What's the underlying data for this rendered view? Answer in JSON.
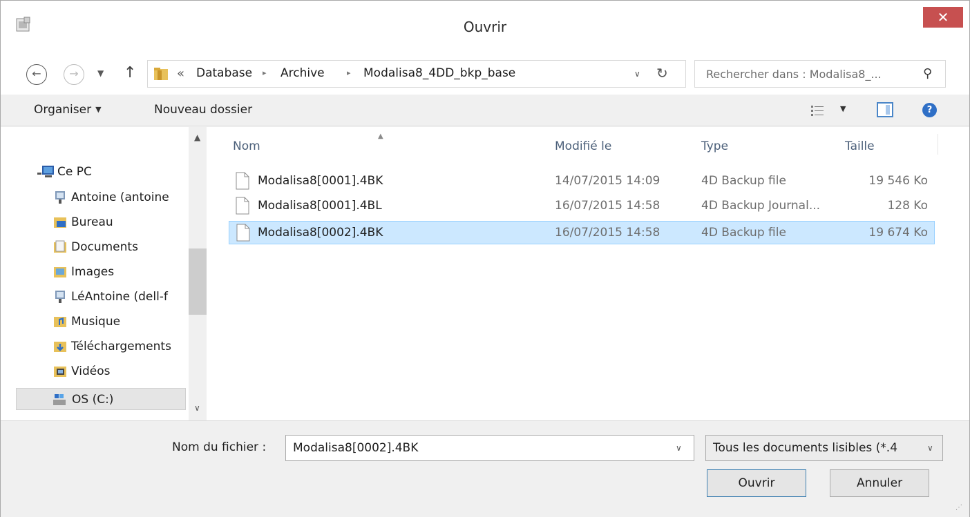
{
  "window": {
    "title": "Ouvrir",
    "close_glyph": "✕",
    "app_icon": "4d-app-icon"
  },
  "address_bar": {
    "overflow_glyph": "«",
    "breadcrumbs": [
      "Database",
      "Archive",
      "Modalisa8_4DD_bkp_base"
    ],
    "separator_glyph": "▸",
    "search_placeholder": "Rechercher dans : Modalisa8_..."
  },
  "toolbar": {
    "organize_label": "Organiser",
    "new_folder_label": "Nouveau dossier"
  },
  "nav_pane": {
    "this_pc_label": "Ce PC",
    "items": [
      {
        "label": "Antoine (antoine",
        "icon": "network-user-icon"
      },
      {
        "label": "Bureau",
        "icon": "desktop-folder-icon"
      },
      {
        "label": "Documents",
        "icon": "documents-folder-icon"
      },
      {
        "label": "Images",
        "icon": "pictures-folder-icon"
      },
      {
        "label": "LéAntoine (dell-f",
        "icon": "network-user-icon"
      },
      {
        "label": "Musique",
        "icon": "music-folder-icon"
      },
      {
        "label": "Téléchargements",
        "icon": "downloads-folder-icon"
      },
      {
        "label": "Vidéos",
        "icon": "videos-folder-icon"
      },
      {
        "label": "OS (C:)",
        "icon": "drive-icon"
      }
    ]
  },
  "file_list": {
    "columns": {
      "name": "Nom",
      "modified": "Modifié le",
      "type": "Type",
      "size": "Taille"
    },
    "rows": [
      {
        "name": "Modalisa8[0001].4BK",
        "modified": "14/07/2015 14:09",
        "type": "4D Backup file",
        "size": "19 546 Ko",
        "selected": false
      },
      {
        "name": "Modalisa8[0001].4BL",
        "modified": "16/07/2015 14:58",
        "type": "4D Backup Journal...",
        "size": "128 Ko",
        "selected": false
      },
      {
        "name": "Modalisa8[0002].4BK",
        "modified": "16/07/2015 14:58",
        "type": "4D Backup file",
        "size": "19 674 Ko",
        "selected": true
      }
    ]
  },
  "footer": {
    "filename_label": "Nom du fichier :",
    "filename_value": "Modalisa8[0002].4BK",
    "filter_label": "Tous les documents lisibles (*.4",
    "open_label": "Ouvrir",
    "cancel_label": "Annuler"
  },
  "colors": {
    "selection_bg": "#cce8ff",
    "selection_border": "#99d1ff",
    "close_bg": "#c75050",
    "header_text": "#4c607a"
  }
}
